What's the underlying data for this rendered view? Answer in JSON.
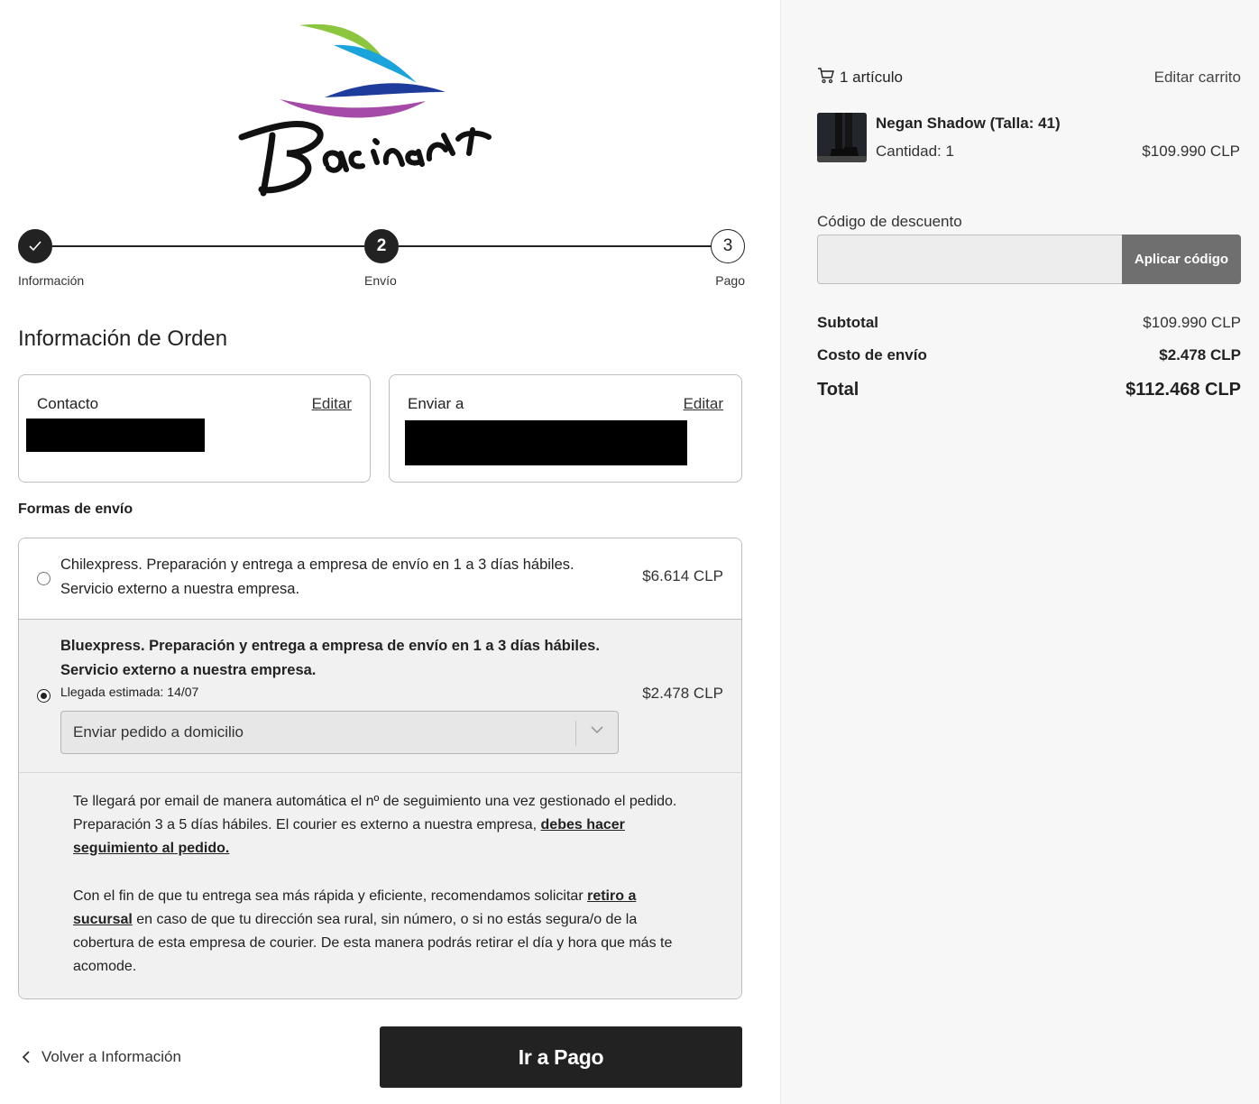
{
  "brand": {
    "logo_text": "Bacinari"
  },
  "stepper": {
    "steps": [
      {
        "label": "Información",
        "number": "✓"
      },
      {
        "label": "Envío",
        "number": "2"
      },
      {
        "label": "Pago",
        "number": "3"
      }
    ]
  },
  "order": {
    "title": "Información de Orden",
    "contact": {
      "label": "Contacto",
      "edit": "Editar"
    },
    "ship_to": {
      "label": "Enviar a",
      "edit": "Editar"
    }
  },
  "shipping": {
    "section_label": "Formas de envío",
    "options": [
      {
        "line1": "Chilexpress. Preparación y entrega a empresa de envío en 1 a 3 días hábiles.",
        "line2": "Servicio externo a nuestra empresa.",
        "price": "$6.614 CLP",
        "selected": false
      },
      {
        "line1": "Bluexpress. Preparación y entrega a empresa de envío en 1 a 3 días hábiles.",
        "line2": "Servicio externo a nuestra empresa.",
        "eta": "Llegada estimada: 14/07",
        "price": "$2.478 CLP",
        "selected": true,
        "delivery_select": "Enviar pedido a domicilio"
      }
    ],
    "note1": {
      "text_a": "Te llegará por email de manera automática el nº de seguimiento una vez gestionado el pedido. Preparación 3 a 5 días hábiles. El courier es externo a nuestra empresa, ",
      "link": "debes hacer seguimiento al pedido."
    },
    "note2": {
      "text_a": "Con el fin de que tu entrega sea más rápida y eficiente, recomendamos solicitar ",
      "link": "retiro a sucursal",
      "text_b": " en caso de que tu dirección sea rural, sin número, o si no estás segura/o de la cobertura de esta empresa de courier. De esta manera podrás retirar el día y hora que más te acomode."
    }
  },
  "nav": {
    "back": "Volver a Información",
    "next": "Ir a Pago"
  },
  "cart": {
    "count_label": "1 artículo",
    "edit_label": "Editar carrito",
    "items": [
      {
        "name": "Negan Shadow (Talla: 41)",
        "qty": "Cantidad: 1",
        "price": "$109.990 CLP"
      }
    ],
    "discount_label": "Código de descuento",
    "discount_value": "",
    "apply_label": "Aplicar código",
    "subtotal_label": "Subtotal",
    "subtotal": "$109.990 CLP",
    "shipping_label": "Costo de envío",
    "shipping": "$2.478 CLP",
    "total_label": "Total",
    "total": "$112.468 CLP"
  },
  "colors": {
    "primary": "#222222",
    "panel": "#f7f7f7",
    "selected_option": "#f1f1f1",
    "apply_button": "#6f6f6f"
  }
}
